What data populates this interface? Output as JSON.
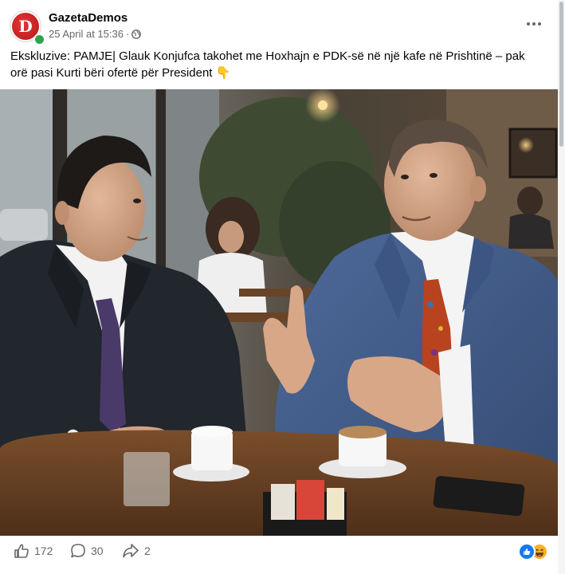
{
  "post": {
    "page_name": "GazetaDemos",
    "timestamp": "25 April at 15:36",
    "separator": "·",
    "audience_icon": "globe-icon",
    "more_icon": "more-horizontal-icon",
    "text": "Ekskluzive: PAMJE| Glauk Konjufca takohet me Hoxhajn e PDK-së në një kafe në Prishtinë – pak orë pasi Kurti bëri ofertë për President 👇",
    "avatar_letter": "D",
    "brand_color": "#c8202a",
    "online_color": "#31a24c"
  },
  "photo": {
    "subject": "two-men-cafe-conversation",
    "icon": "photo"
  },
  "actions": {
    "like_count": "172",
    "comment_count": "30",
    "share_count": "2",
    "reactions": [
      "like",
      "haha"
    ],
    "like_color": "#1877f2",
    "haha_color": "#f7b125"
  }
}
